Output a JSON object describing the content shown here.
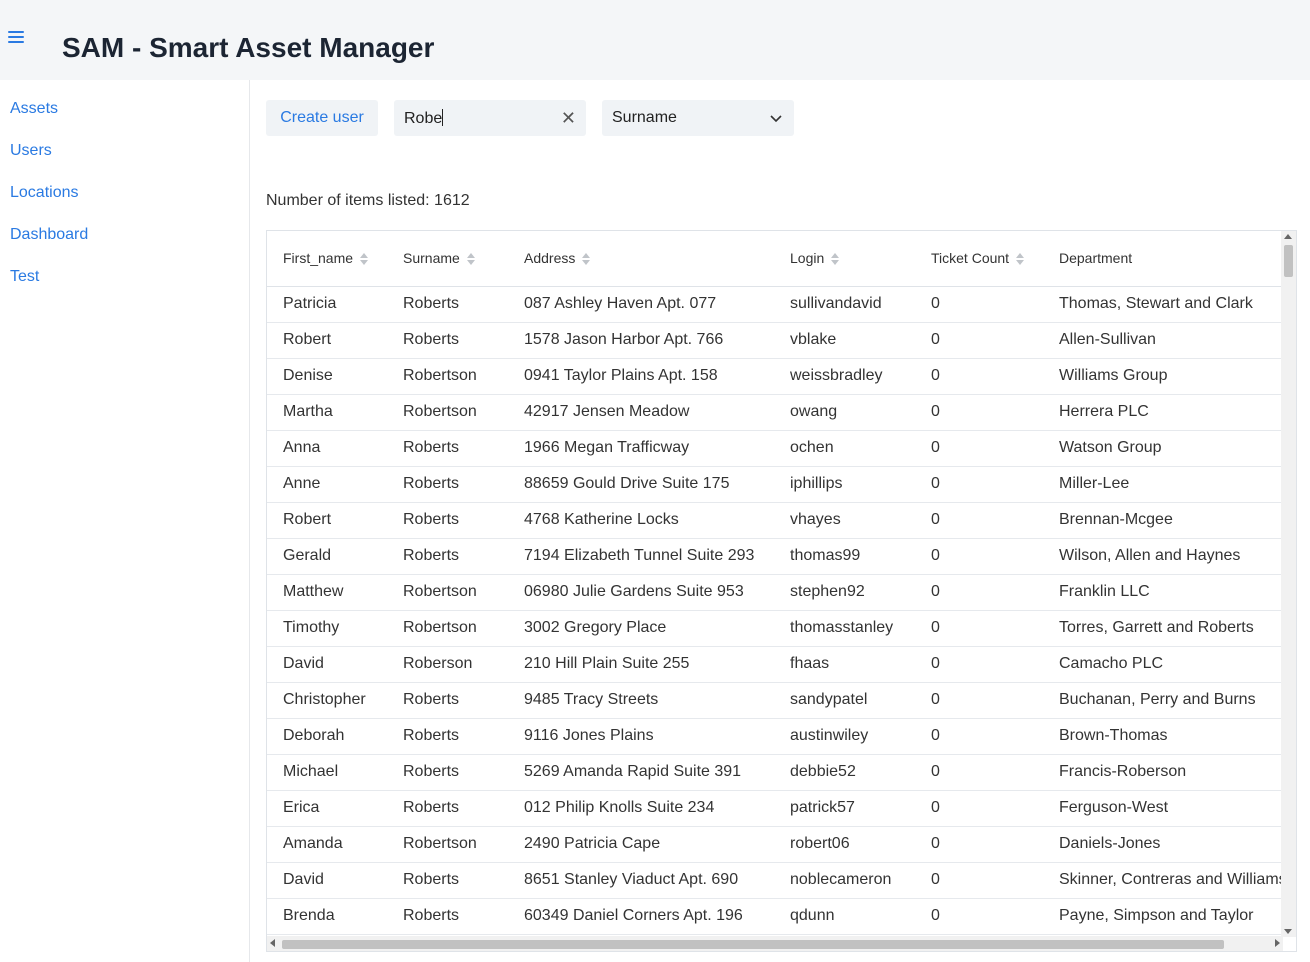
{
  "app": {
    "title": "SAM - Smart Asset Manager"
  },
  "sidebar": {
    "items": [
      {
        "label": "Assets"
      },
      {
        "label": "Users"
      },
      {
        "label": "Locations"
      },
      {
        "label": "Dashboard"
      },
      {
        "label": "Test"
      }
    ]
  },
  "toolbar": {
    "create_label": "Create user",
    "search_value": "Robe",
    "clear_icon": "close-icon",
    "select_value": "Surname"
  },
  "list": {
    "count_text": "Number of items listed: 1612"
  },
  "table": {
    "columns": [
      "First_name",
      "Surname",
      "Address",
      "Login",
      "Ticket Count",
      "Department"
    ],
    "rows": [
      [
        "Patricia",
        "Roberts",
        "087 Ashley Haven Apt. 077",
        "sullivandavid",
        "0",
        "Thomas, Stewart and Clark"
      ],
      [
        "Robert",
        "Roberts",
        "1578 Jason Harbor Apt. 766",
        "vblake",
        "0",
        "Allen-Sullivan"
      ],
      [
        "Denise",
        "Robertson",
        "0941 Taylor Plains Apt. 158",
        "weissbradley",
        "0",
        "Williams Group"
      ],
      [
        "Martha",
        "Robertson",
        "42917 Jensen Meadow",
        "owang",
        "0",
        "Herrera PLC"
      ],
      [
        "Anna",
        "Roberts",
        "1966 Megan Trafficway",
        "ochen",
        "0",
        "Watson Group"
      ],
      [
        "Anne",
        "Roberts",
        "88659 Gould Drive Suite 175",
        "iphillips",
        "0",
        "Miller-Lee"
      ],
      [
        "Robert",
        "Roberts",
        "4768 Katherine Locks",
        "vhayes",
        "0",
        "Brennan-Mcgee"
      ],
      [
        "Gerald",
        "Roberts",
        "7194 Elizabeth Tunnel Suite 293",
        "thomas99",
        "0",
        "Wilson, Allen and Haynes"
      ],
      [
        "Matthew",
        "Robertson",
        "06980 Julie Gardens Suite 953",
        "stephen92",
        "0",
        "Franklin LLC"
      ],
      [
        "Timothy",
        "Robertson",
        "3002 Gregory Place",
        "thomasstanley",
        "0",
        "Torres, Garrett and Roberts"
      ],
      [
        "David",
        "Roberson",
        "210 Hill Plain Suite 255",
        "fhaas",
        "0",
        "Camacho PLC"
      ],
      [
        "Christopher",
        "Roberts",
        "9485 Tracy Streets",
        "sandypatel",
        "0",
        "Buchanan, Perry and Burns"
      ],
      [
        "Deborah",
        "Roberts",
        "9116 Jones Plains",
        "austinwiley",
        "0",
        "Brown-Thomas"
      ],
      [
        "Michael",
        "Roberts",
        "5269 Amanda Rapid Suite 391",
        "debbie52",
        "0",
        "Francis-Roberson"
      ],
      [
        "Erica",
        "Roberts",
        "012 Philip Knolls Suite 234",
        "patrick57",
        "0",
        "Ferguson-West"
      ],
      [
        "Amanda",
        "Robertson",
        "2490 Patricia Cape",
        "robert06",
        "0",
        "Daniels-Jones"
      ],
      [
        "David",
        "Roberts",
        "8651 Stanley Viaduct Apt. 690",
        "noblecameron",
        "0",
        "Skinner, Contreras and Williams"
      ],
      [
        "Brenda",
        "Roberts",
        "60349 Daniel Corners Apt. 196",
        "qdunn",
        "0",
        "Payne, Simpson and Taylor"
      ]
    ]
  },
  "colors": {
    "accent": "#2a7ae2",
    "header_bg": "#f4f6f8",
    "input_bg": "#f0f3f6"
  }
}
